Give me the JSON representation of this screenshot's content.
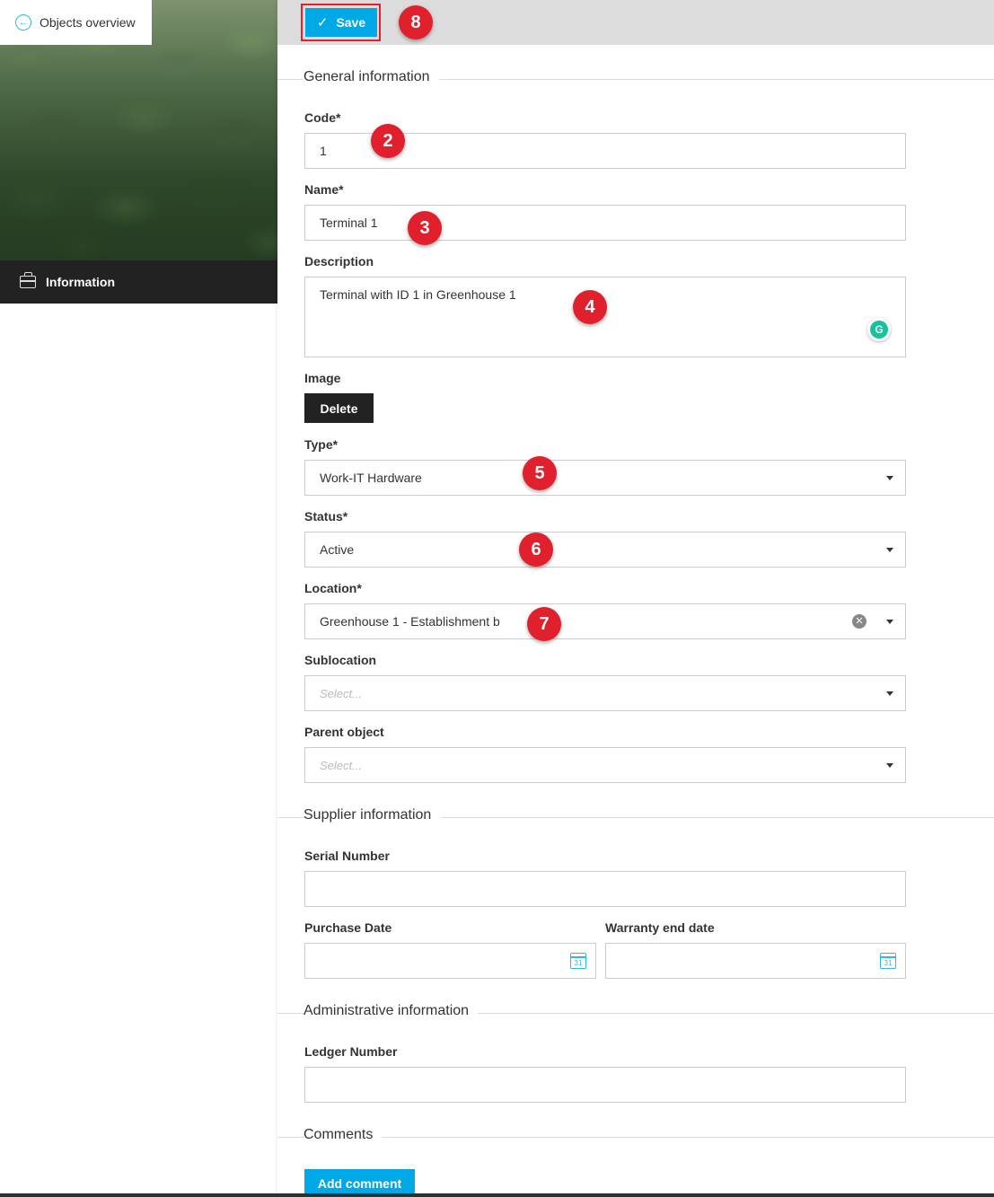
{
  "nav": {
    "back_label": "Objects overview",
    "info_tab_label": "Information"
  },
  "toolbar": {
    "save_label": "Save",
    "save_icon": "✓"
  },
  "sections": {
    "general": "General information",
    "supplier": "Supplier information",
    "administrative": "Administrative information",
    "comments": "Comments"
  },
  "form": {
    "code": {
      "label": "Code*",
      "value": "1"
    },
    "name": {
      "label": "Name*",
      "value": "Terminal 1"
    },
    "description": {
      "label": "Description",
      "value": "Terminal with ID 1 in Greenhouse 1"
    },
    "image": {
      "label": "Image",
      "delete_label": "Delete"
    },
    "type": {
      "label": "Type*",
      "value": "Work-IT Hardware"
    },
    "status": {
      "label": "Status*",
      "value": "Active"
    },
    "location": {
      "label": "Location*",
      "value": "Greenhouse 1 - Establishment b"
    },
    "sublocation": {
      "label": "Sublocation",
      "placeholder": "Select..."
    },
    "parent_object": {
      "label": "Parent object",
      "placeholder": "Select..."
    },
    "serial_number": {
      "label": "Serial Number",
      "value": ""
    },
    "purchase_date": {
      "label": "Purchase Date",
      "value": "",
      "calendar_day": "31"
    },
    "warranty_end_date": {
      "label": "Warranty end date",
      "value": "",
      "calendar_day": "31"
    },
    "ledger_number": {
      "label": "Ledger Number",
      "value": ""
    }
  },
  "comments": {
    "add_label": "Add comment"
  },
  "markers": [
    "2",
    "3",
    "4",
    "5",
    "6",
    "7",
    "8"
  ],
  "colors": {
    "accent": "#00a8e6",
    "marker": "#e0202c",
    "dark": "#222222"
  }
}
